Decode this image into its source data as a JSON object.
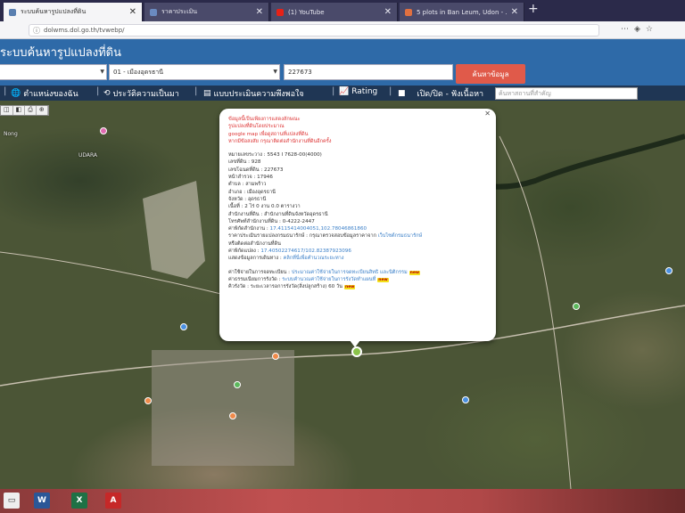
{
  "browser": {
    "tabs": [
      {
        "title": "ระบบค้นหารูปแปลงที่ดิน",
        "favicon_color": "#5a7fb0"
      },
      {
        "title": "ราคาประเมิน",
        "favicon_color": "#6a8ac0"
      },
      {
        "title": "(1) YouTube",
        "favicon_color": "#e62117"
      },
      {
        "title": "5 plots in Ban Leum, Udon - ...",
        "favicon_color": "#e07040"
      }
    ],
    "url": "dolwms.dol.go.th/tvwebp/"
  },
  "site": {
    "title": "ระบบค้นหารูปแปลงที่ดิน",
    "province_select": "",
    "district_select": "01 - เมืองอุดรธานี",
    "parcel_input": "227673",
    "search_button": "ค้นหาข้อมูล",
    "landmark_placeholder": "ค้นหาสถานที่สำคัญ"
  },
  "menu": [
    {
      "label": "ตำแหน่งของฉัน",
      "icon": "globe-icon"
    },
    {
      "label": "ประวัติความเป็นมา",
      "icon": "history-icon"
    },
    {
      "label": "แบบประเมินความพึงพอใจ",
      "icon": "form-icon"
    },
    {
      "label": "Rating",
      "icon": "chart-icon"
    },
    {
      "label": "เปิด/ปิด - ฟังเนื้อหา",
      "icon": "toggle-icon"
    }
  ],
  "map": {
    "tools": [
      "◫",
      "◧",
      "⎙",
      "⊕"
    ],
    "labels": [
      "Nong",
      "UDARA"
    ]
  },
  "popup": {
    "notice": [
      "ข้อมูลนี้เป็นเพียงการแสดงลักษณะ",
      "รูปแปลงที่ดินโดยประมาณ",
      "google map เพื่อดูสถานที่แปลงที่ดิน",
      "หากมีข้อสงสัย กรุณาติดต่อสำนักงานที่ดินอีกครั้ง"
    ],
    "details": [
      {
        "label": "หมายเลขระวาง",
        "value": "5543 I 7628-00(4000)"
      },
      {
        "label": "เลขที่ดิน",
        "value": "928"
      },
      {
        "label": "เลขโฉนดที่ดิน",
        "value": "227673"
      },
      {
        "label": "หน้าสำรวจ",
        "value": "17946"
      },
      {
        "label": "ตำบล",
        "value": "สามพร้าว"
      },
      {
        "label": "อำเภอ",
        "value": "เมืองอุดรธานี"
      },
      {
        "label": "จังหวัด",
        "value": "อุดรธานี"
      },
      {
        "label": "เนื้อที่",
        "value": "2 ไร่ 0 งาน 0.0 ตารางวา"
      },
      {
        "label": "สำนักงานที่ดิน",
        "value": "สำนักงานที่ดินจังหวัดอุดรธานี"
      },
      {
        "label": "โทรศัพท์สำนักงานที่ดิน",
        "value": "0-4222-2447"
      }
    ],
    "coord_label": "ค่าพิกัดสำนักงาน",
    "coord_value": "17.4115414004051,102.78046861860",
    "price_label": "ราคาประเมินรายแปลงกรมธนารักษ์",
    "price_value": "กรุณาตรวจสอบข้อมูลราคาจาก",
    "price_link": "เว็บไซต์กรมธนารักษ์",
    "price_tail": "หรือติดต่อสำนักงานที่ดิน",
    "parcel_coord_label": "ค่าพิกัดแปลง",
    "parcel_coord_value": "17.40502274617/102.82387923096",
    "owner_label": "แสดงข้อมูลการเดินทาง",
    "owner_value": "คลิกที่นี่เพื่อคำนวณระยะทาง",
    "services": [
      {
        "label": "ค่าใช้จ่ายในการจดทะเบียน",
        "value": "ประมาณค่าใช้จ่ายในการจดทะเบียนสิทธิ และนิติกรรม",
        "new": "new"
      },
      {
        "label": "ค่าธรรมเนียมการรังวัด",
        "value": "ระบบคำนวณค่าใช้จ่ายในการรังวัดทำแผนที่",
        "new": "new"
      },
      {
        "label": "คิวรังวัด",
        "value": "ระยะเวลารอการรังวัด(สิ่งปลูกสร้าง) 60 วัน",
        "new": "new"
      }
    ]
  },
  "taskbar": {
    "apps": [
      {
        "name": "word",
        "label": "W",
        "color": "#2b5797"
      },
      {
        "name": "excel",
        "label": "X",
        "color": "#1e7145"
      },
      {
        "name": "pdf",
        "label": "A",
        "color": "#c62828"
      }
    ]
  }
}
